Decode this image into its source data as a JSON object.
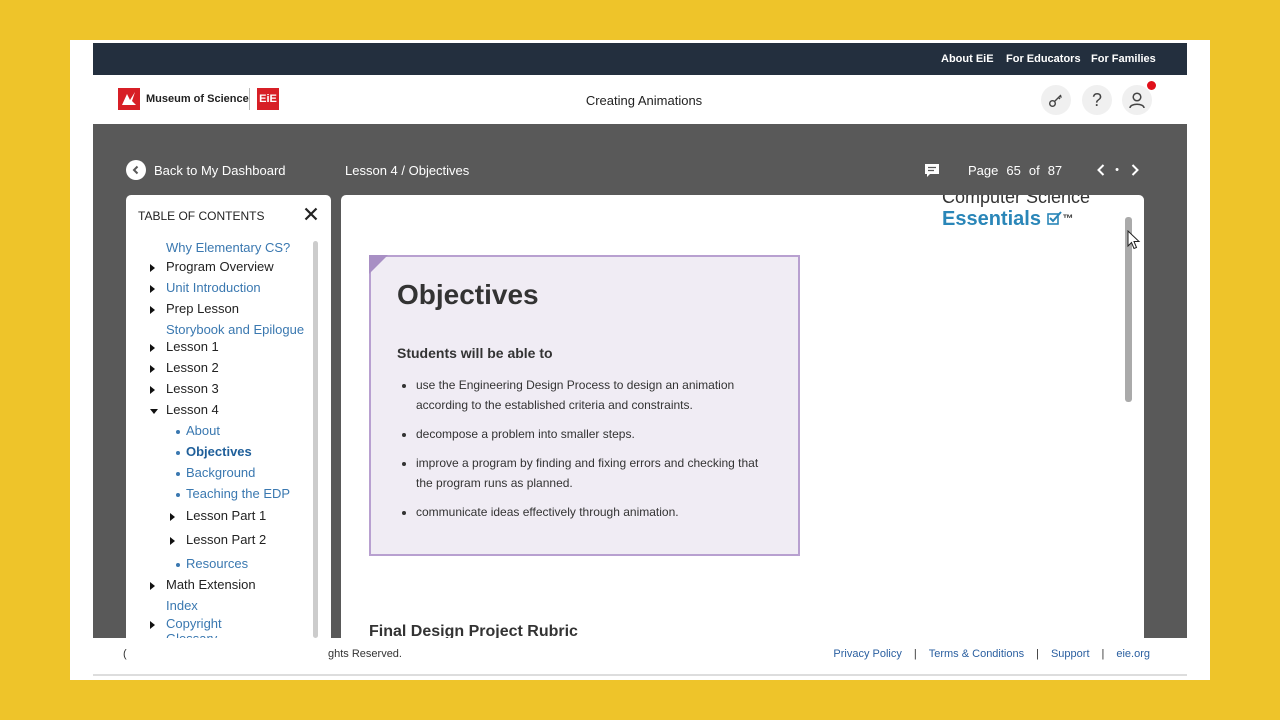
{
  "topnav": {
    "about": "About EiE",
    "educators": "For Educators",
    "families": "For Families"
  },
  "header": {
    "museum": "Museum of Science",
    "eie": "EiE",
    "title": "Creating Animations"
  },
  "nav": {
    "back": "Back to My Dashboard",
    "breadcrumb": "Lesson 4  /  Objectives",
    "page_label": "Page",
    "page_current": "65",
    "page_of": "of",
    "page_total": "87",
    "dot": "•"
  },
  "toc": {
    "heading": "TABLE OF CONTENTS",
    "items": [
      {
        "label": "Why Elementary CS?",
        "style": "link",
        "expander": "none"
      },
      {
        "label": "Program Overview",
        "style": "dark",
        "expander": "right"
      },
      {
        "label": "Unit Introduction",
        "style": "link",
        "expander": "right"
      },
      {
        "label": "Prep Lesson",
        "style": "dark",
        "expander": "right"
      },
      {
        "label": "Storybook and Epilogue",
        "style": "link",
        "expander": "none"
      },
      {
        "label": "Lesson 1",
        "style": "dark",
        "expander": "right"
      },
      {
        "label": "Lesson 2",
        "style": "dark",
        "expander": "right"
      },
      {
        "label": "Lesson 3",
        "style": "dark",
        "expander": "right"
      },
      {
        "label": "Lesson 4",
        "style": "dark",
        "expander": "down"
      },
      {
        "label": "About",
        "style": "link",
        "expander": "bullet"
      },
      {
        "label": "Objectives",
        "style": "active",
        "expander": "bullet"
      },
      {
        "label": "Background",
        "style": "link",
        "expander": "bullet"
      },
      {
        "label": "Teaching the EDP",
        "style": "link",
        "expander": "bullet"
      },
      {
        "label": "Lesson Part 1",
        "style": "dark",
        "expander": "right"
      },
      {
        "label": "Lesson Part 2",
        "style": "dark",
        "expander": "right"
      },
      {
        "label": "Resources",
        "style": "link",
        "expander": "bullet"
      },
      {
        "label": "Math Extension",
        "style": "dark",
        "expander": "right"
      },
      {
        "label": "Index",
        "style": "link",
        "expander": "none"
      },
      {
        "label": "Copyright",
        "style": "link",
        "expander": "right"
      },
      {
        "label": "Glossary",
        "style": "link",
        "expander": "none"
      }
    ]
  },
  "doc": {
    "brand_line1": "Computer Science",
    "brand_line2": "Essentials",
    "brand_tm": "™",
    "heading": "Objectives",
    "subheading": "Students will be able to",
    "bullets": [
      "use the Engineering Design Process to design an animation according to the established criteria and constraints.",
      "decompose a problem into smaller steps.",
      "improve a program by finding and fixing errors and checking that the program runs as planned.",
      "communicate ideas effectively through animation."
    ],
    "next_heading": "Final Design Project Rubric"
  },
  "footer": {
    "copyright_fragment": "(",
    "rights": "ghts Reserved.",
    "privacy": "Privacy Policy",
    "terms": "Terms & Conditions",
    "support": "Support",
    "site": "eie.org"
  },
  "colors": {
    "background": "#EEC42A",
    "topbar": "#232f3e",
    "accent_red": "#d71f26",
    "link": "#3a78b0",
    "panel": "#595959"
  }
}
